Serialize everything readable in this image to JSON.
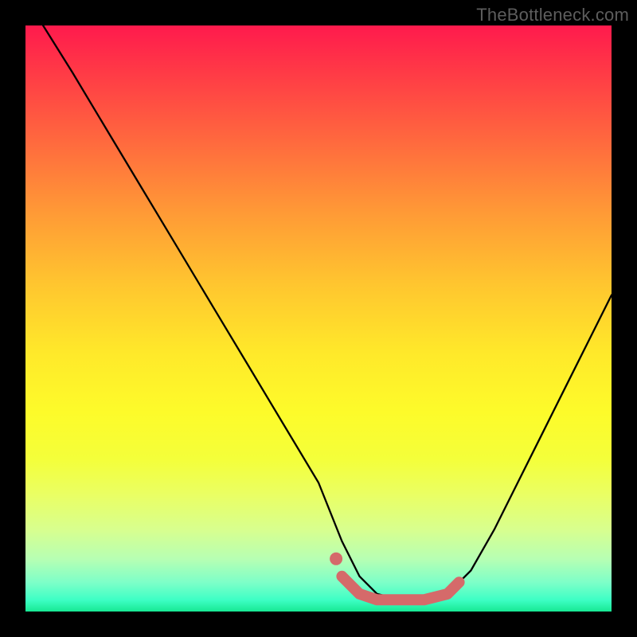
{
  "watermark": "TheBottleneck.com",
  "chart_data": {
    "type": "line",
    "title": "",
    "xlabel": "",
    "ylabel": "",
    "xlim": [
      0,
      100
    ],
    "ylim": [
      0,
      100
    ],
    "series": [
      {
        "name": "bottleneck-curve",
        "x": [
          3,
          8,
          14,
          20,
          26,
          32,
          38,
          44,
          50,
          54,
          57,
          60,
          64,
          68,
          72,
          76,
          80,
          84,
          88,
          92,
          96,
          100
        ],
        "y": [
          100,
          92,
          82,
          72,
          62,
          52,
          42,
          32,
          22,
          12,
          6,
          3,
          2,
          2,
          3,
          7,
          14,
          22,
          30,
          38,
          46,
          54
        ]
      },
      {
        "name": "highlight-segment",
        "x": [
          54,
          57,
          60,
          64,
          68,
          72,
          74
        ],
        "y": [
          6,
          3,
          2,
          2,
          2,
          3,
          5
        ]
      }
    ],
    "gradient_stops": [
      {
        "pos": 0,
        "color": "#ff1a4d"
      },
      {
        "pos": 50,
        "color": "#ffe92a"
      },
      {
        "pos": 100,
        "color": "#17e893"
      }
    ]
  }
}
